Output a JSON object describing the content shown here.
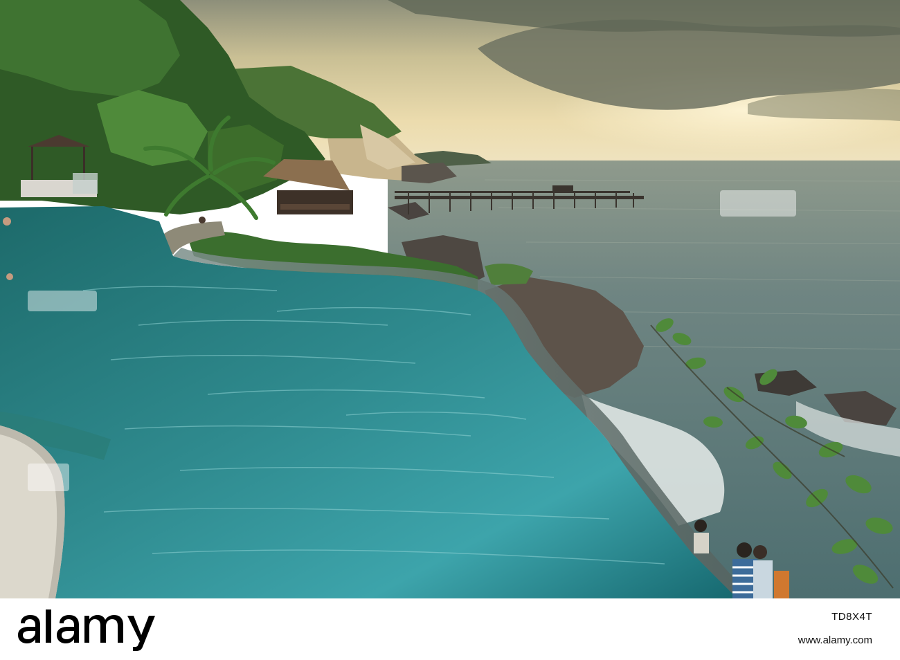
{
  "image": {
    "description_tags": [
      "infinity-pool",
      "ocean",
      "cliffs",
      "pier",
      "sunset-sky",
      "tropical-trees",
      "restaurant-hut",
      "people"
    ]
  },
  "footer": {
    "logo_text": "alamy",
    "image_id": "TD8X4T",
    "url": "www.alamy.com"
  },
  "colors": {
    "sky_light": "#e9dcae",
    "sky_cloud": "#6f7563",
    "sea": "#5d7c7c",
    "pool_deep": "#1c6f74",
    "pool_light": "#3f9ea3",
    "foliage": "#3c6a2c",
    "cliff": "#c9b892",
    "rock": "#4a4440"
  }
}
